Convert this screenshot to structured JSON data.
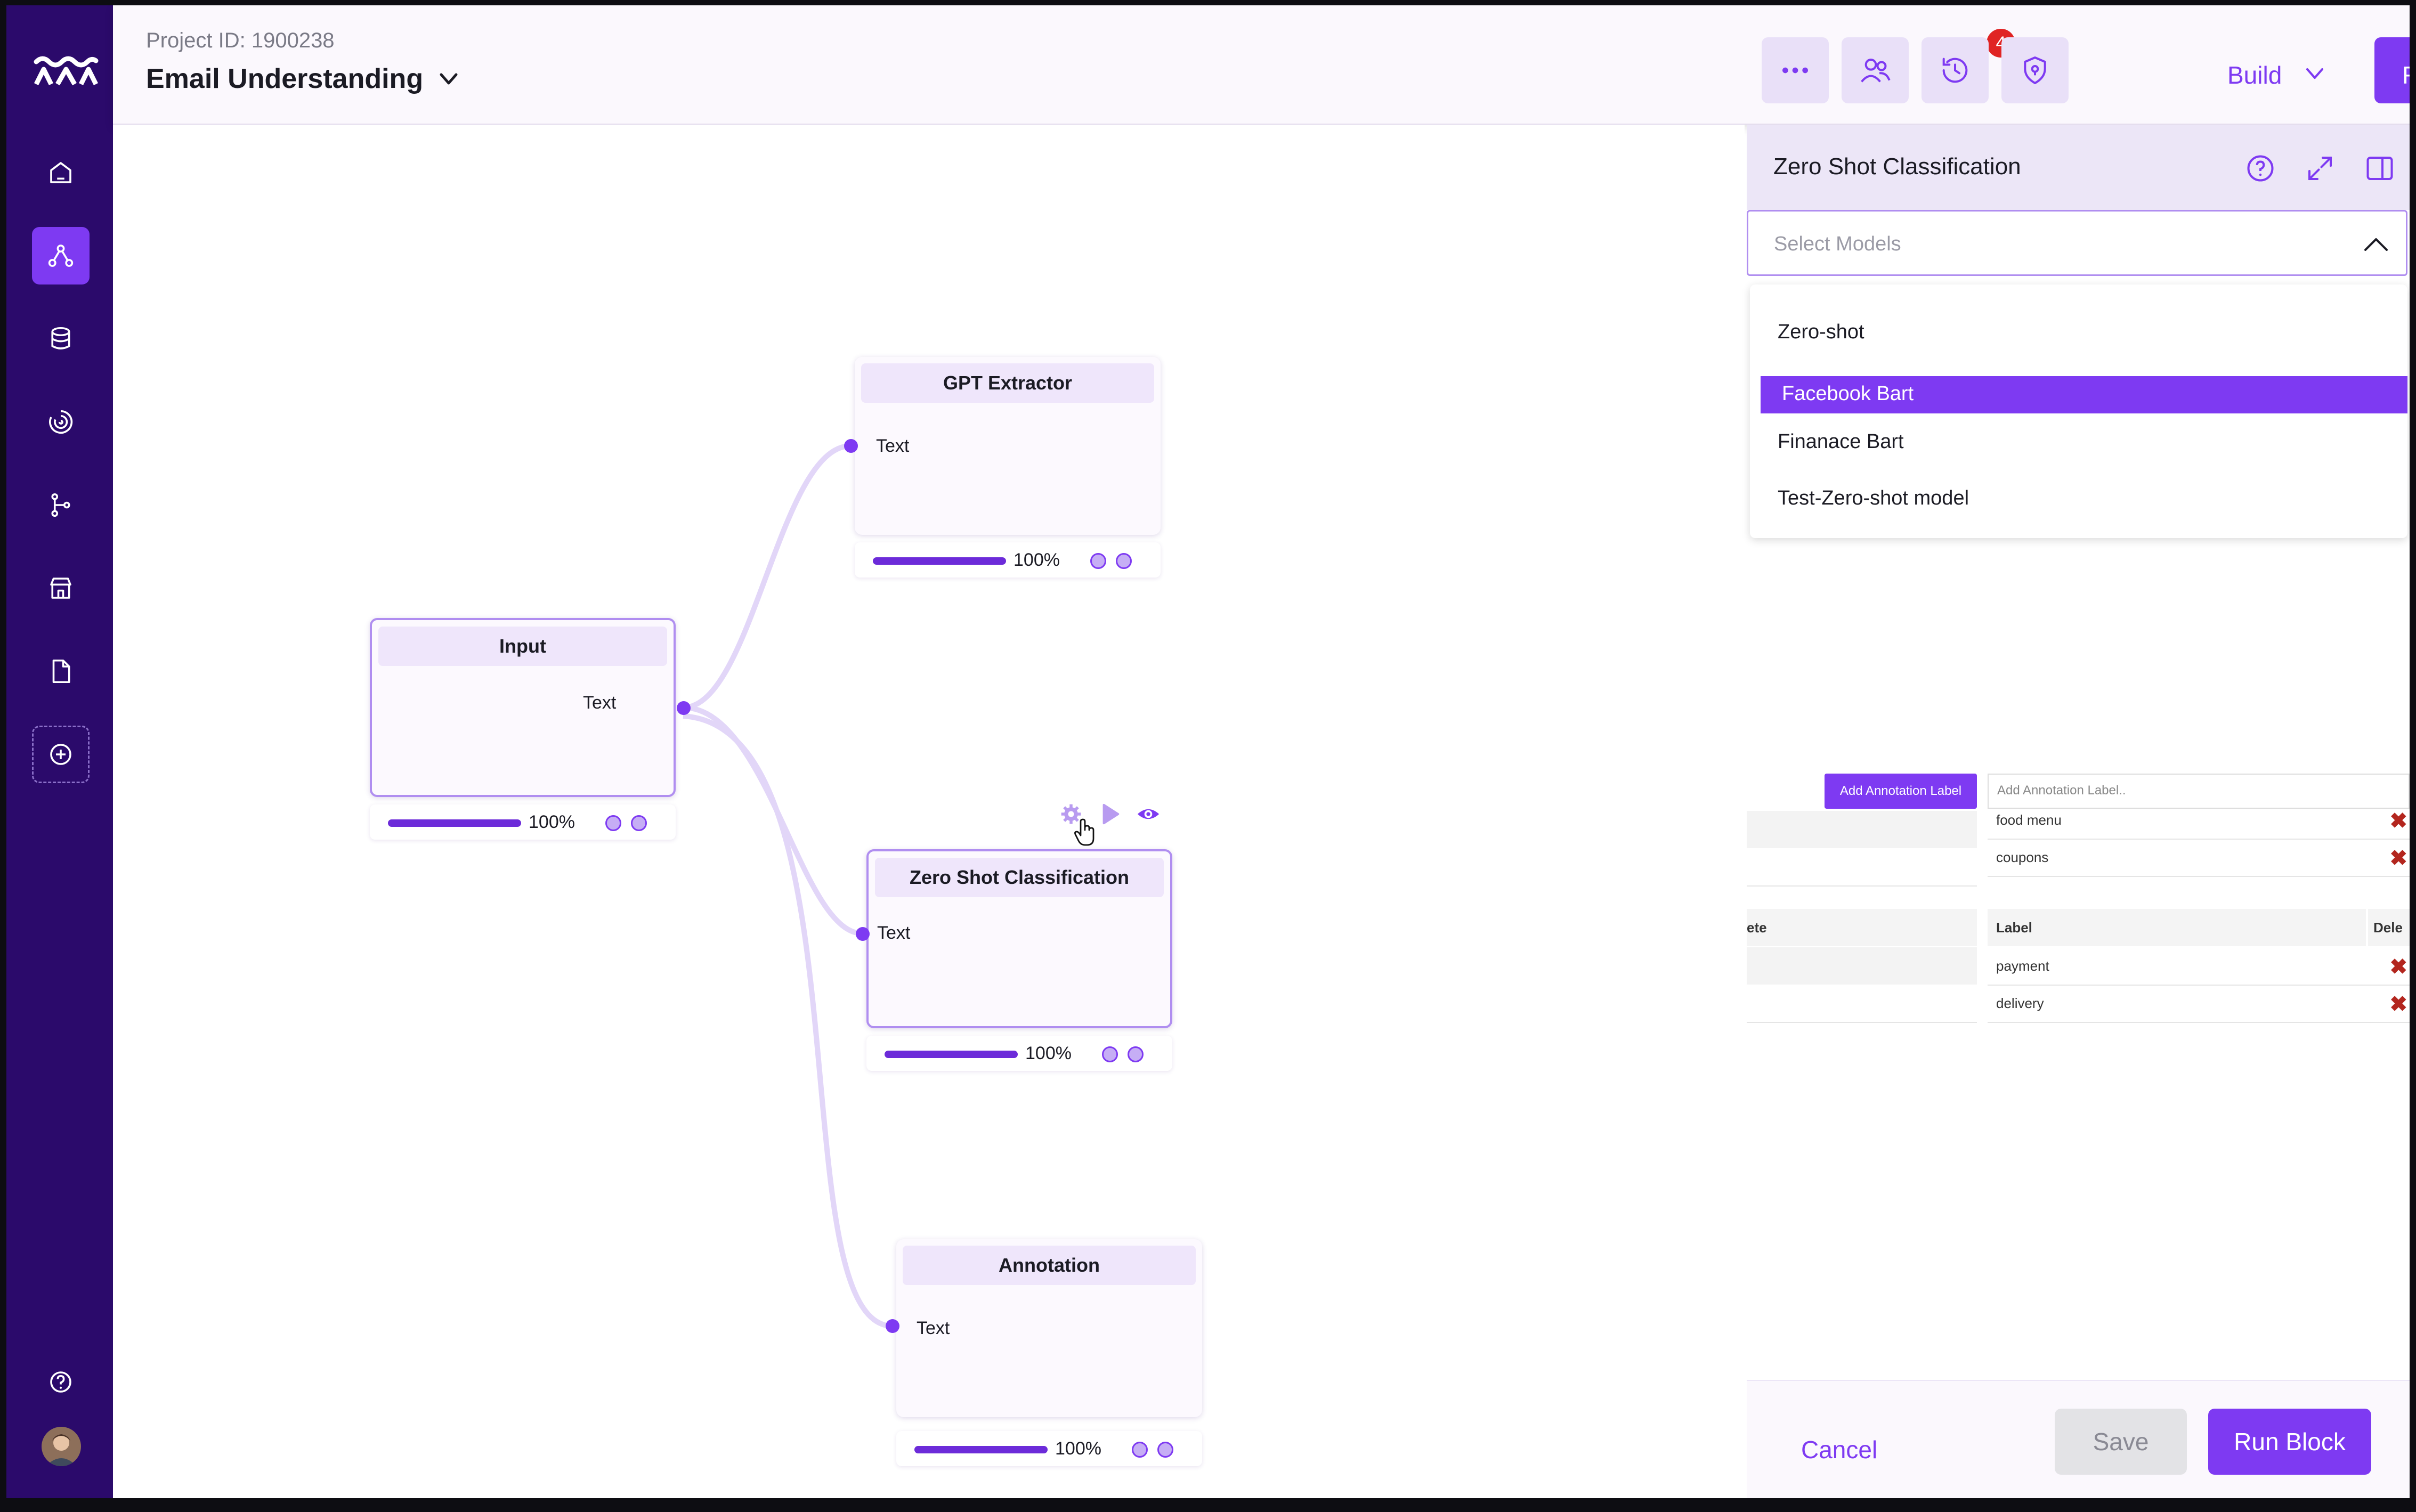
{
  "header": {
    "project_id": "Project ID: 1900238",
    "project_title": "Email Understanding",
    "notification_count": "4",
    "build_label": "Build",
    "run_label": "Run"
  },
  "nodes": {
    "input": {
      "title": "Input",
      "port_label": "Text",
      "progress": "100%",
      "progress_value": 1.0
    },
    "gpt_extractor": {
      "title": "GPT Extractor",
      "port_label": "Text",
      "progress": "100%",
      "progress_value": 1.0
    },
    "zero_shot": {
      "title": "Zero Shot Classification",
      "port_label": "Text",
      "progress": "100%",
      "progress_value": 1.0
    },
    "annotation": {
      "title": "Annotation",
      "port_label": "Text",
      "progress": "100%",
      "progress_value": 1.0
    }
  },
  "panel": {
    "title": "Zero Shot Classification",
    "select_placeholder": "Select Models",
    "options": [
      "Zero-shot",
      "Facebook Bart",
      "Finanace Bart",
      "Test-Zero-shot model"
    ],
    "selected_option": "Facebook Bart",
    "annotation": {
      "add_button": "Add Annotation Label",
      "input_placeholder": "Add Annotation Label..",
      "top_rows": [
        "food menu",
        "coupons"
      ],
      "col_left": "ete",
      "col_label": "Label",
      "col_delete": "Dele",
      "rows": [
        "payment",
        "delivery"
      ]
    },
    "cancel_label": "Cancel",
    "save_label": "Save",
    "run_block_label": "Run Block"
  },
  "colors": {
    "accent": "#7e3af2",
    "sidebar": "#2b0a6b",
    "danger": "#e02424"
  }
}
